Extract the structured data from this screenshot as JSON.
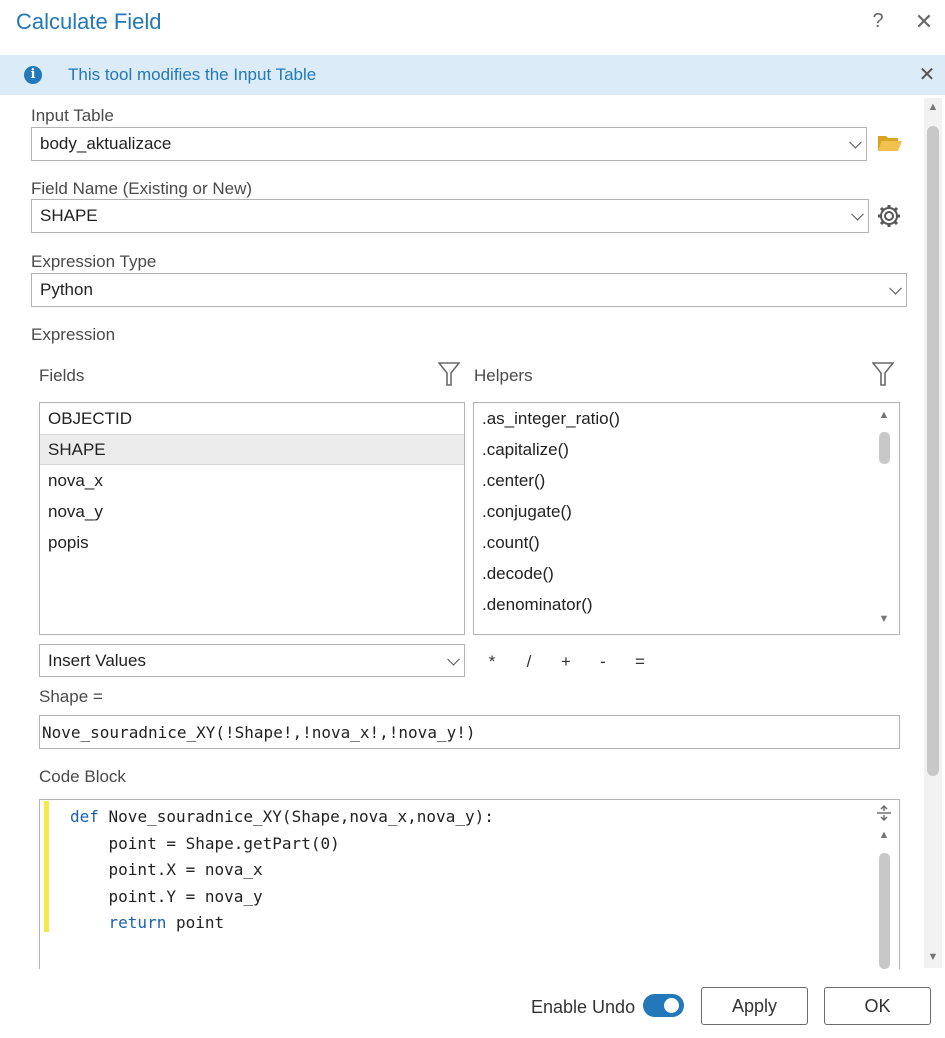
{
  "window": {
    "title": "Calculate Field",
    "help_label": "?",
    "close_label": "✕"
  },
  "banner": {
    "message": "This tool modifies the Input Table",
    "icon": "info-icon",
    "close_label": "✕"
  },
  "input_table": {
    "label": "Input Table",
    "value": "body_aktualizace"
  },
  "field_name": {
    "label": "Field Name (Existing or New)",
    "value": "SHAPE"
  },
  "expression_type": {
    "label": "Expression Type",
    "value": "Python"
  },
  "expression": {
    "label": "Expression",
    "fields_label": "Fields",
    "helpers_label": "Helpers",
    "fields": [
      "OBJECTID",
      "SHAPE",
      "nova_x",
      "nova_y",
      "popis"
    ],
    "selected_field": "SHAPE",
    "helpers": [
      ".as_integer_ratio()",
      ".capitalize()",
      ".center()",
      ".conjugate()",
      ".count()",
      ".decode()",
      ".denominator()"
    ],
    "insert_values": "Insert Values",
    "operators": [
      "*",
      "/",
      "+",
      "-",
      "="
    ],
    "target_label": "Shape =",
    "value": "Nove_souradnice_XY(!Shape!,!nova_x!,!nova_y!)"
  },
  "code_block": {
    "label": "Code Block",
    "lines": [
      {
        "indent": "",
        "keyword": "def",
        "rest": " Nove_souradnice_XY(Shape,nova_x,nova_y):"
      },
      {
        "indent": "    ",
        "keyword": "",
        "rest": "point = Shape.getPart(0)"
      },
      {
        "indent": "    ",
        "keyword": "",
        "rest": "point.X = nova_x"
      },
      {
        "indent": "    ",
        "keyword": "",
        "rest": "point.Y = nova_y"
      },
      {
        "indent": "    ",
        "keyword": "return",
        "rest": " point"
      }
    ]
  },
  "footer": {
    "enable_undo_label": "Enable Undo",
    "enable_undo_on": true,
    "apply_label": "Apply",
    "ok_label": "OK"
  },
  "colors": {
    "accent": "#2278b8",
    "banner_bg": "#dcebf8",
    "code_gutter_marker": "#f5e94a"
  }
}
